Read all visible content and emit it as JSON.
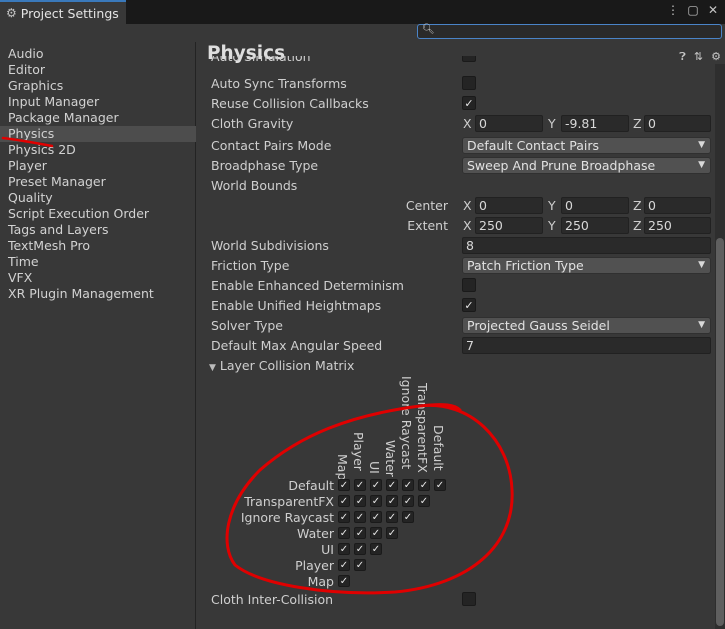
{
  "window": {
    "tab_title": "Project Settings",
    "controls": [
      "⋮",
      "▢",
      "✕"
    ]
  },
  "search": {
    "placeholder": "",
    "value": ""
  },
  "sidebar": {
    "items": [
      {
        "label": "Audio"
      },
      {
        "label": "Editor"
      },
      {
        "label": "Graphics"
      },
      {
        "label": "Input Manager"
      },
      {
        "label": "Package Manager"
      },
      {
        "label": "Physics",
        "selected": true
      },
      {
        "label": "Physics 2D"
      },
      {
        "label": "Player"
      },
      {
        "label": "Preset Manager"
      },
      {
        "label": "Quality"
      },
      {
        "label": "Script Execution Order"
      },
      {
        "label": "Tags and Layers"
      },
      {
        "label": "TextMesh Pro"
      },
      {
        "label": "Time"
      },
      {
        "label": "VFX"
      },
      {
        "label": "XR Plugin Management"
      }
    ]
  },
  "main": {
    "title": "Physics",
    "header_icons": [
      "help-icon",
      "presets-icon",
      "settings-icon"
    ],
    "cut_label": "Auto Simulation",
    "auto_sync": {
      "label": "Auto Sync Transforms",
      "checked": false
    },
    "reuse_callbacks": {
      "label": "Reuse Collision Callbacks",
      "checked": true
    },
    "cloth_gravity": {
      "label": "Cloth Gravity",
      "x": "0",
      "y": "-9.81",
      "z": "0"
    },
    "contact_pairs": {
      "label": "Contact Pairs Mode",
      "value": "Default Contact Pairs"
    },
    "broadphase": {
      "label": "Broadphase Type",
      "value": "Sweep And Prune Broadphase"
    },
    "world_bounds": {
      "label": "World Bounds",
      "center_label": "Center",
      "extent_label": "Extent",
      "center": {
        "x": "0",
        "y": "0",
        "z": "0"
      },
      "extent": {
        "x": "250",
        "y": "250",
        "z": "250"
      }
    },
    "axis": {
      "x": "X",
      "y": "Y",
      "z": "Z"
    },
    "world_subdivisions": {
      "label": "World Subdivisions",
      "value": "8"
    },
    "friction_type": {
      "label": "Friction Type",
      "value": "Patch Friction Type"
    },
    "enhanced_determinism": {
      "label": "Enable Enhanced Determinism",
      "checked": false
    },
    "unified_heightmaps": {
      "label": "Enable Unified Heightmaps",
      "checked": true
    },
    "solver_type": {
      "label": "Solver Type",
      "value": "Projected Gauss Seidel"
    },
    "max_angular_speed": {
      "label": "Default Max Angular Speed",
      "value": "7"
    },
    "matrix": {
      "label": "Layer Collision Matrix",
      "columns": [
        "Map",
        "Player",
        "UI",
        "Water",
        "Ignore Raycast",
        "TransparentFX",
        "Default"
      ],
      "rows": [
        "Default",
        "TransparentFX",
        "Ignore Raycast",
        "Water",
        "UI",
        "Player",
        "Map"
      ]
    },
    "cloth_inter_collision": {
      "label": "Cloth Inter-Collision",
      "checked": false
    }
  },
  "colors": {
    "accent": "#3a79bb",
    "annotation": "#e00000"
  }
}
